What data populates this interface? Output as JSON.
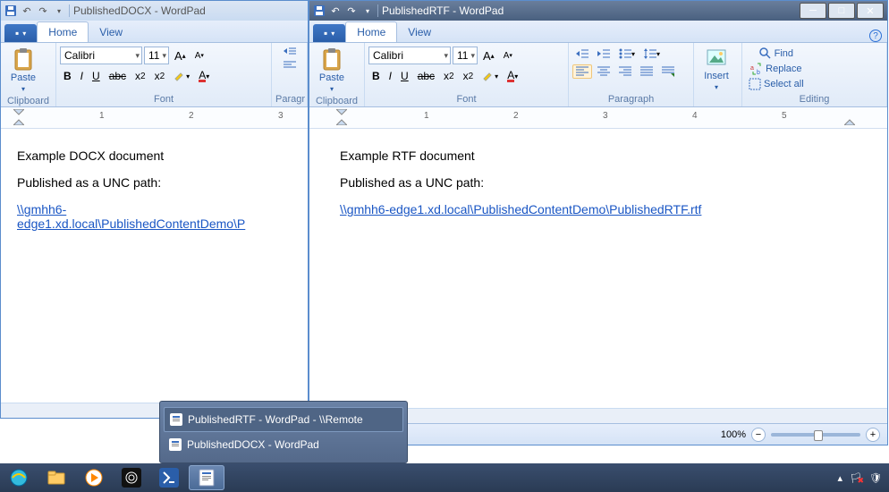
{
  "win1": {
    "title": "PublishedDOCX - WordPad",
    "tabs": {
      "home": "Home",
      "view": "View"
    },
    "font": "Calibri",
    "size": "11",
    "groups": {
      "clipboard": "Clipboard",
      "font": "Font",
      "paragraph": "Paragr"
    },
    "paste": "Paste",
    "doc": {
      "line1": "Example DOCX document",
      "line2": "Published as a UNC path:",
      "link": "\\\\gmhh6-edge1.xd.local\\PublishedContentDemo\\P"
    }
  },
  "win2": {
    "title": "PublishedRTF - WordPad",
    "tabs": {
      "home": "Home",
      "view": "View"
    },
    "font": "Calibri",
    "size": "11",
    "groups": {
      "clipboard": "Clipboard",
      "font": "Font",
      "paragraph": "Paragraph",
      "editing": "Editing"
    },
    "paste": "Paste",
    "insert": "Insert",
    "editing": {
      "find": "Find",
      "replace": "Replace",
      "selectall": "Select all"
    },
    "doc": {
      "line1": "Example RTF document",
      "line2": "Published as a UNC path:",
      "link": "\\\\gmhh6-edge1.xd.local\\PublishedContentDemo\\PublishedRTF.rtf"
    },
    "zoom": "100%"
  },
  "preview": {
    "item1": "PublishedRTF - WordPad - \\\\Remote",
    "item2": "PublishedDOCX - WordPad"
  },
  "ruler": {
    "m1": "1",
    "m2": "2",
    "m3": "3",
    "m4": "4",
    "m5": "5"
  }
}
